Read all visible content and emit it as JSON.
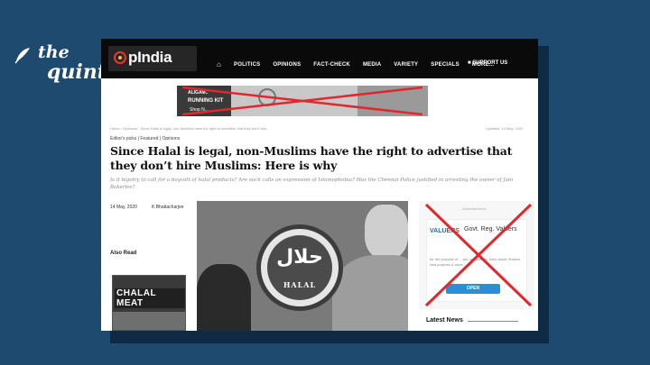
{
  "brand": {
    "line1": "the",
    "line2": "quint"
  },
  "site": {
    "logo": "pIndia",
    "nav": [
      "POLITICS",
      "OPINIONS",
      "FACT-CHECK",
      "MEDIA",
      "VARIETY",
      "SPECIALS",
      "MORE..."
    ],
    "support": "SUPPORT US"
  },
  "banner_ad": {
    "line1": "ALIGAM..",
    "line2": "RUNNING KIT",
    "line3": "Shop N..."
  },
  "article": {
    "breadcrumb": "Home  ›  Opinions  ›  Since Halal is legal, non-Muslims have the right to advertise that they don't hire...",
    "updated": "Updated: 14 May, 2020",
    "tags": "Editor's picks  |  Featured  |  Opinions",
    "headline": "Since Halal is legal, non-Muslims have the right to advertise that they don’t hire Muslims: Here is why",
    "subheadline": "Is it bigotry to call for a boycott of halal products? Are such calls an expression of Islamophobia? Was the Chennai Police justified in arresting the owner of Jain Bakeries?",
    "date": "14 May, 2020",
    "author": "K Bhattacharjee",
    "also_read": "Also Read",
    "thumb_text": "CHALAL MEAT",
    "image": {
      "arabic": "حلال",
      "label": "HALAL"
    }
  },
  "side_ad": {
    "label": "- Advertisement -",
    "brand": "VALUERS",
    "headline": "Govt. Reg. Valuers",
    "text": "for the purpose of ... tax, income tax, fixed asset, finance, visa purpose & more...",
    "button": "OPEN"
  },
  "latest_news": "Latest News",
  "colors": {
    "background": "#1d4a6e",
    "site_bar": "#0a0a0a",
    "cross": "#e0282d",
    "open_button": "#2a8fd6"
  }
}
